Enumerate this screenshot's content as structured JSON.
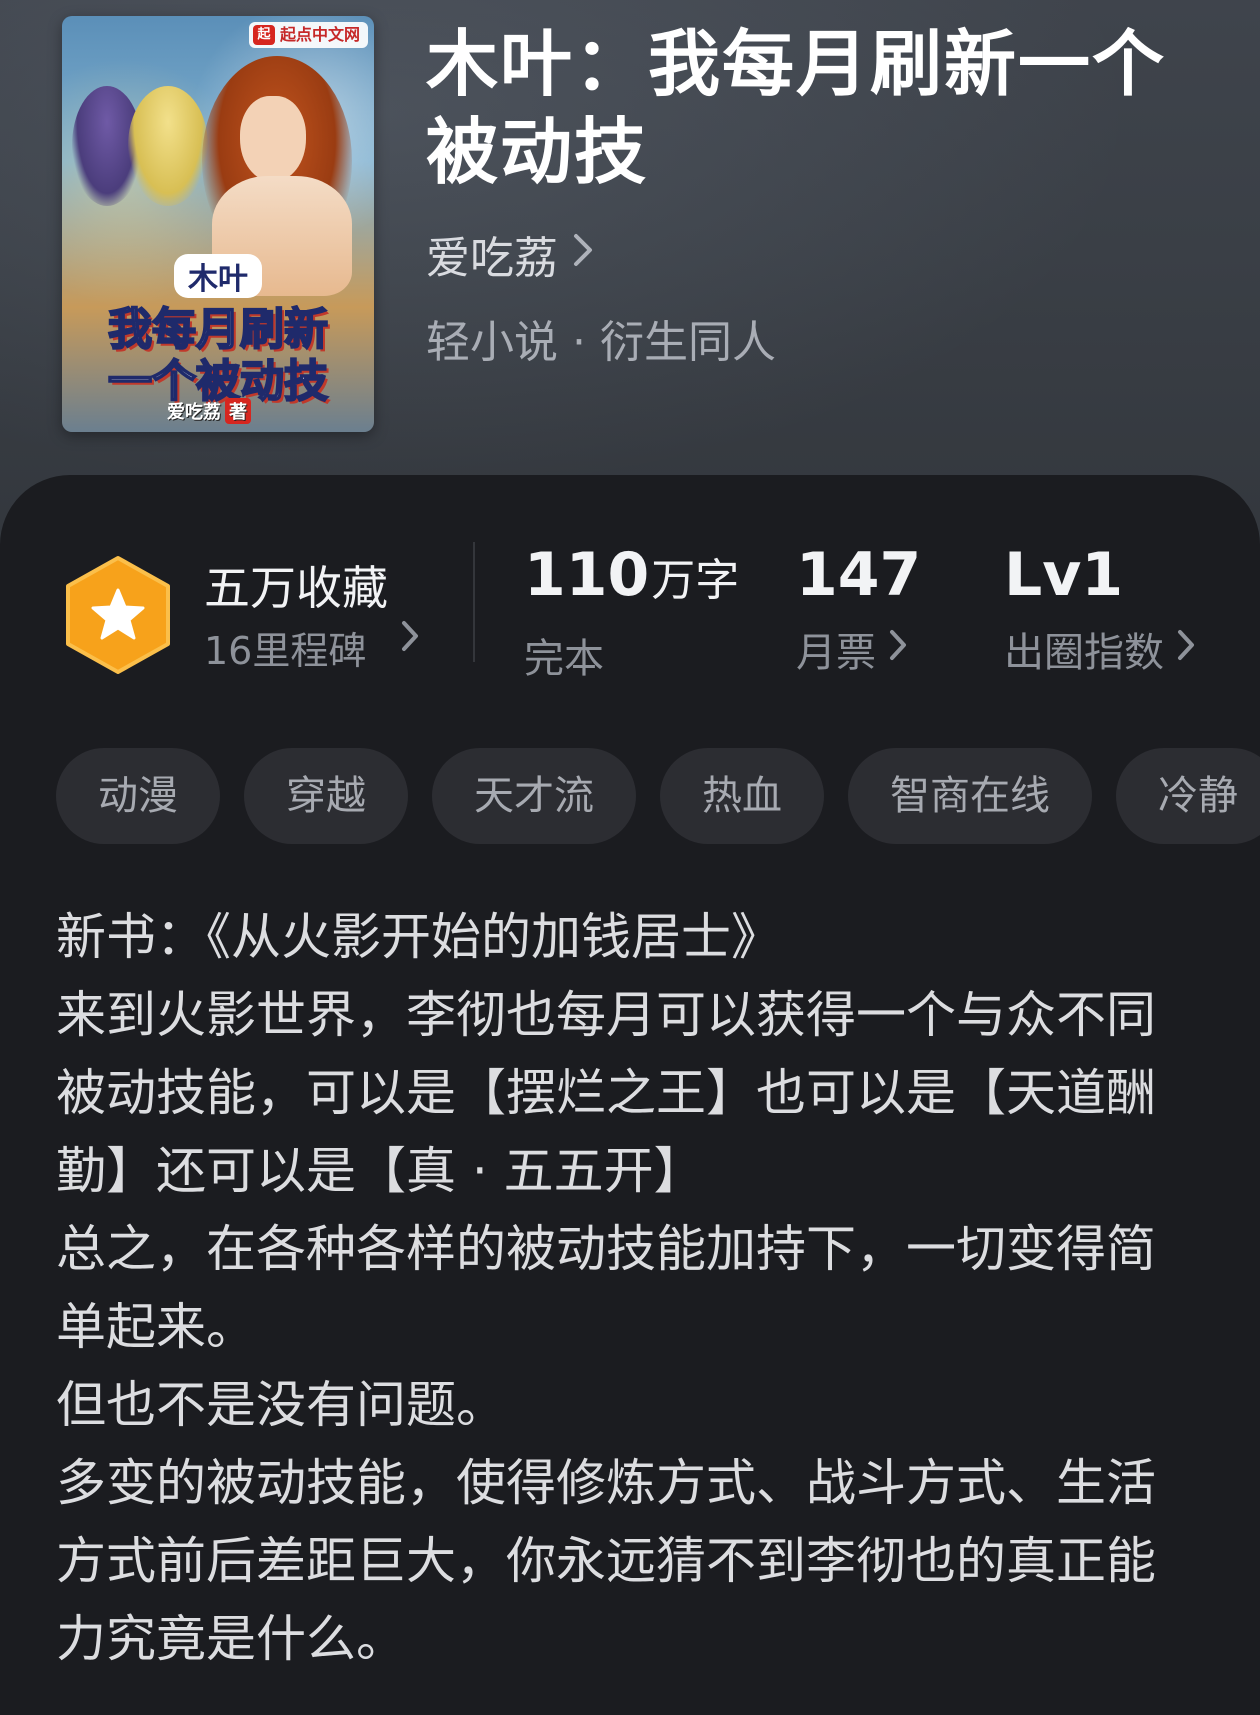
{
  "book": {
    "title": "木叶：我每月刷新一个被动技",
    "author": "爱吃荔",
    "genre": "轻小说 · 衍生同人"
  },
  "cover": {
    "brand": "起点中文网",
    "brand_mark": "起",
    "title_small": "木叶",
    "title_line1": "我每月刷新",
    "title_line2": "一个被动技",
    "author": "爱吃荔",
    "author_suffix": "著"
  },
  "stats": {
    "collect_title": "五万收藏",
    "collect_sub": "16里程碑",
    "words_value": "110",
    "words_unit": "万字",
    "words_label": "完本",
    "monthly_value": "147",
    "monthly_label": "月票",
    "influence_value": "Lv1",
    "influence_label": "出圈指数"
  },
  "tags": [
    "动漫",
    "穿越",
    "天才流",
    "热血",
    "智商在线",
    "冷静"
  ],
  "synopsis": [
    "新书：《从火影开始的加钱居士》",
    "来到火影世界，李彻也每月可以获得一个与众不同被动技能，可以是【摆烂之王】也可以是【天道酬勤】还可以是【真 · 五五开】",
    "总之，在各种各样的被动技能加持下，一切变得简单起来。",
    "但也不是没有问题。",
    "多变的被动技能，使得修炼方式、战斗方式、生活方式前后差距巨大，你永远猜不到李彻也的真正能力究竟是什么。"
  ],
  "colors": {
    "badge_orange": "#f7a21b",
    "panel_bg": "#1b1c20",
    "tag_bg": "#2c2d32"
  }
}
